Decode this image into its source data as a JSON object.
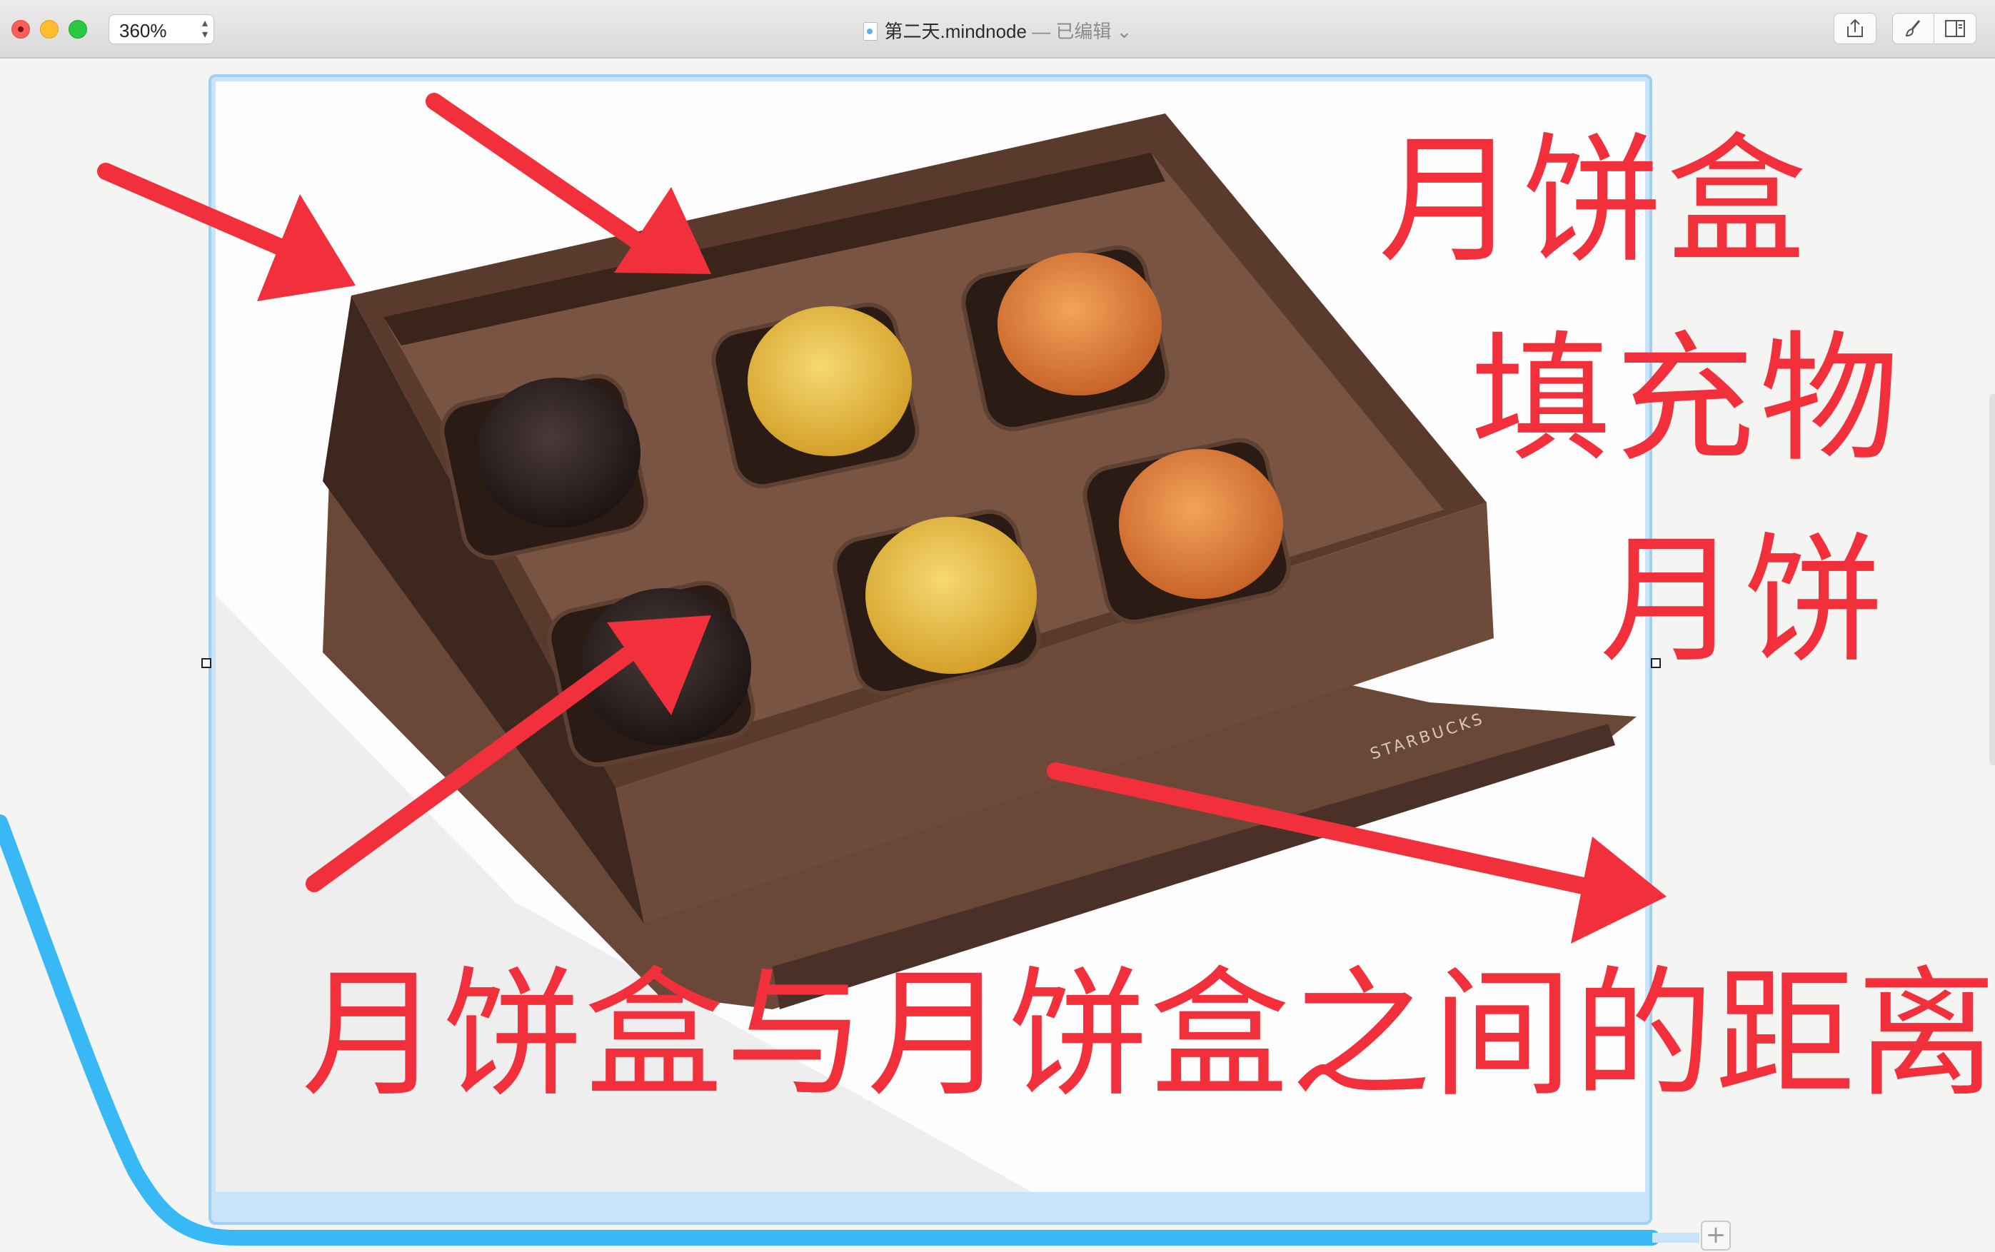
{
  "window": {
    "zoom_value": "360%",
    "document_name": "第二天.mindnode",
    "title_separator": " — ",
    "edited_status": "已编辑",
    "title_chevron": "⌄"
  },
  "toolbar": {
    "share_icon": "share-icon",
    "style_icon": "brush-icon",
    "sidebar_icon": "sidebar-icon"
  },
  "canvas": {
    "annotations": [
      "月饼盒",
      "填充物",
      "月饼",
      "月饼盒与月饼盒之间的距离"
    ],
    "add_button_label": "+",
    "box_brand_text": "STARBUCKS",
    "accent_color": "#f1303c",
    "connector_color": "#38b9f5"
  }
}
